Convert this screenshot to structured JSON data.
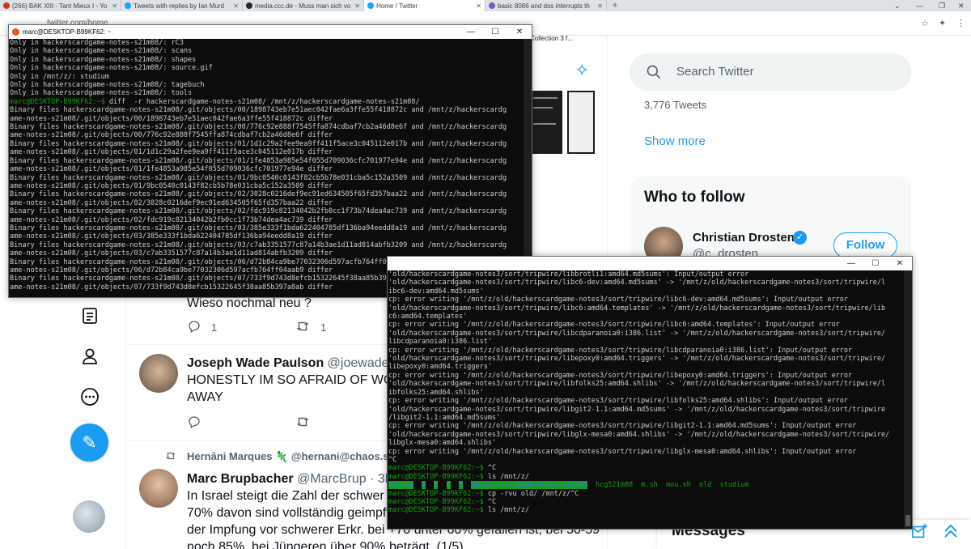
{
  "browser": {
    "tabs": [
      {
        "title": "(266) BAK XIII - Tant Mieux I - Yo",
        "icon": "youtube-icon"
      },
      {
        "title": "Tweets with replies by Ian Murd",
        "icon": "twitter-icon"
      },
      {
        "title": "media.ccc.de - Muss man sich vo",
        "icon": "github-icon"
      },
      {
        "title": "Home / Twitter",
        "icon": "twitter-icon"
      },
      {
        "title": "basic 8086 and dos interrupts th",
        "icon": "page-icon"
      }
    ],
    "url": "twitter.com/home",
    "bookmark_fragment": "Collection 3 f..."
  },
  "twitter": {
    "tweet1": {
      "text": "Wieso nochmal neu ?",
      "reply_count": "1",
      "retweet_count": "1"
    },
    "tweet2": {
      "name": "Joseph Wade Paulson",
      "handle": "@joewadepau",
      "text_line1": "HONESTLY IM SO AFRAID OF WOMEN",
      "text_line2": "AWAY"
    },
    "tweet3": {
      "retweeted_by": "Hernâni Marques 🦎 @hernani@chaos.so",
      "name": "Marc Brupbacher",
      "handle": "@MarcBrup",
      "time": "· 3h",
      "lines": [
        "In Israel steigt die Zahl der schwer Cov",
        "70% davon sind vollständig geimpft. D",
        "der Impfung vor schwerer Erkr. bei +70 unter 60% gefallen ist, bei 50-59",
        "noch 85%, bei Jüngeren über 90% beträgt. (1/5)"
      ]
    },
    "search_placeholder": "Search Twitter",
    "tweets_count": "3,776 Tweets",
    "show_more": "Show more",
    "who_to_follow": "Who to follow",
    "suggestion": {
      "name": "Christian Drosten",
      "handle": "@c_drosten",
      "follow_label": "Follow"
    },
    "messages_title": "Messages",
    "accent_color": "#1d9bf0"
  },
  "terminal1": {
    "title": "marc@DESKTOP-B99KF62: ~",
    "lines": [
      {
        "t": "Only in hackerscardgame-notes-s21m08/: rC3",
        "c": ""
      },
      {
        "t": "Only in hackerscardgame-notes-s21m08/: scans",
        "c": ""
      },
      {
        "t": "Only in hackerscardgame-notes-s21m08/: shapes",
        "c": ""
      },
      {
        "t": "Only in hackerscardgame-notes-s21m08/: source.gif",
        "c": ""
      },
      {
        "t": "Only in /mnt/z/: studium",
        "c": ""
      },
      {
        "t": "Only in hackerscardgame-notes-s21m08/: tagebuch",
        "c": ""
      },
      {
        "t": "Only in hackerscardgame-notes-s21m08/: tools",
        "c": ""
      },
      {
        "t": "marc@DESKTOP-B99KF62:~$ diff  -r hackerscardgame-notes-s21m08/ /mnt/z/hackerscardgame-notes-s21m08/",
        "c": "prompt"
      },
      {
        "t": "Binary files hackerscardgame-notes-s21m08/.git/objects/00/1898743eb7e51aec042fae6a3ffe55f418872c and /mnt/z/hackerscardg",
        "c": ""
      },
      {
        "t": "ame-notes-s21m08/.git/objects/00/1898743eb7e51aec042fae6a3ffe55f418872c differ",
        "c": ""
      },
      {
        "t": "Binary files hackerscardgame-notes-s21m08/.git/objects/00/776c92e888f7545ffa874cdbaf7cb2a46d8e6f and /mnt/z/hackerscardg",
        "c": ""
      },
      {
        "t": "ame-notes-s21m08/.git/objects/00/776c92e888f7545ffa874cdbaf7cb2a46d8e6f differ",
        "c": ""
      },
      {
        "t": "Binary files hackerscardgame-notes-s21m08/.git/objects/01/1d1c29a2fee9ea9ff411f5ace3c045112e017b and /mnt/z/hackerscardg",
        "c": ""
      },
      {
        "t": "ame-notes-s21m08/.git/objects/01/1d1c29a2fee9ea9ff411f5ace3c045112e017b differ",
        "c": ""
      },
      {
        "t": "Binary files hackerscardgame-notes-s21m08/.git/objects/01/1fe4853a985e54f055d709036cfc701977e94e and /mnt/z/hackerscardg",
        "c": ""
      },
      {
        "t": "ame-notes-s21m08/.git/objects/01/1fe4853a985e54f055d709036cfc701977e94e differ",
        "c": ""
      },
      {
        "t": "Binary files hackerscardgame-notes-s21m08/.git/objects/01/9bc0540c0143f82cb5b78e031cba5c152a3509 and /mnt/z/hackerscardg",
        "c": ""
      },
      {
        "t": "ame-notes-s21m08/.git/objects/01/9bc0540c0143f82cb5b78e031cba5c152a3509 differ",
        "c": ""
      },
      {
        "t": "Binary files hackerscardgame-notes-s21m08/.git/objects/02/3028c0216def9ec91ed634505f65fd357baa22 and /mnt/z/hackerscardg",
        "c": ""
      },
      {
        "t": "ame-notes-s21m08/.git/objects/02/3028c0216def9ec91ed634505f65fd357baa22 differ",
        "c": ""
      },
      {
        "t": "Binary files hackerscardgame-notes-s21m08/.git/objects/02/fdc919c82134042b2fb0cc1f73b74dea4ac739 and /mnt/z/hackerscardg",
        "c": ""
      },
      {
        "t": "ame-notes-s21m08/.git/objects/02/fdc919c82134042b2fb0cc1f73b74dea4ac739 differ",
        "c": ""
      },
      {
        "t": "Binary files hackerscardgame-notes-s21m08/.git/objects/03/385e333f1bda622404785df136ba94eedd8a19 and /mnt/z/hackerscardg",
        "c": ""
      },
      {
        "t": "ame-notes-s21m08/.git/objects/03/385e333f1bda622404785df136ba94eedd8a19 differ",
        "c": ""
      },
      {
        "t": "Binary files hackerscardgame-notes-s21m08/.git/objects/03/c7ab3351577c87a14b3ae1d11ad814abfb3209 and /mnt/z/hackerscardg",
        "c": ""
      },
      {
        "t": "ame-notes-s21m08/.git/objects/03/c7ab3351577c87a14b3ae1d11ad814abfb3209 differ",
        "c": ""
      },
      {
        "t": "Binary files hackerscardgame-notes-s21m08/.git/objects/06/d72b84ca9be77032306d597acfb764ff04aab9 and /mnt/z/hackerscardg",
        "c": ""
      },
      {
        "t": "ame-notes-s21m08/.git/objects/06/d72b84ca9be77032306d597acfb764ff04aab9 differ",
        "c": ""
      },
      {
        "t": "Binary files hackerscardgame-notes-s21m08/.git/objects/07/733f9d743d8efcb15322645f38aa85b397a8ab and /mnt/z/hackerscardg",
        "c": ""
      },
      {
        "t": "ame-notes-s21m08/.git/objects/07/733f9d743d8efcb15322645f38aa85b397a8ab differ",
        "c": ""
      }
    ]
  },
  "terminal2": {
    "lines": [
      {
        "t": "'old/hackerscardgame-notes3/sort/tripwire/libbrotli1:amd64.md5sums': Input/output error",
        "c": ""
      },
      {
        "t": "'old/hackerscardgame-notes3/sort/tripwire/libc6-dev:amd64.md5sums' -> '/mnt/z/old/hackerscardgame-notes3/sort/tripwire/l",
        "c": ""
      },
      {
        "t": "ibc6-dev:amd64.md5sums'",
        "c": ""
      },
      {
        "t": "cp: error writing '/mnt/z/old/hackerscardgame-notes3/sort/tripwire/libc6-dev:amd64.md5sums': Input/output error",
        "c": ""
      },
      {
        "t": "'old/hackerscardgame-notes3/sort/tripwire/libc6:amd64.templates' -> '/mnt/z/old/hackerscardgame-notes3/sort/tripwire/lib",
        "c": ""
      },
      {
        "t": "c6:amd64.templates'",
        "c": ""
      },
      {
        "t": "cp: error writing '/mnt/z/old/hackerscardgame-notes3/sort/tripwire/libc6:amd64.templates': Input/output error",
        "c": ""
      },
      {
        "t": "'old/hackerscardgame-notes3/sort/tripwire/libcdparanoia0:i386.list' -> '/mnt/z/old/hackerscardgame-notes3/sort/tripwire/",
        "c": ""
      },
      {
        "t": "libcdparanoia0:i386.list'",
        "c": ""
      },
      {
        "t": "cp: error writing '/mnt/z/old/hackerscardgame-notes3/sort/tripwire/libcdparanoia0:i386.list': Input/output error",
        "c": ""
      },
      {
        "t": "'old/hackerscardgame-notes3/sort/tripwire/libepoxy0:amd64.triggers' -> '/mnt/z/old/hackerscardgame-notes3/sort/tripwire/",
        "c": ""
      },
      {
        "t": "libepoxy0:amd64.triggers'",
        "c": ""
      },
      {
        "t": "cp: error writing '/mnt/z/old/hackerscardgame-notes3/sort/tripwire/libepoxy0:amd64.triggers': Input/output error",
        "c": ""
      },
      {
        "t": "'old/hackerscardgame-notes3/sort/tripwire/libfolks25:amd64.shlibs' -> '/mnt/z/old/hackerscardgame-notes3/sort/tripwire/l",
        "c": ""
      },
      {
        "t": "ibfolks25:amd64.shlibs'",
        "c": ""
      },
      {
        "t": "cp: error writing '/mnt/z/old/hackerscardgame-notes3/sort/tripwire/libfolks25:amd64.shlibs': Input/output error",
        "c": ""
      },
      {
        "t": "'old/hackerscardgame-notes3/sort/tripwire/libgit2-1.1:amd64.md5sums' -> '/mnt/z/old/hackerscardgame-notes3/sort/tripwire",
        "c": ""
      },
      {
        "t": "/libgit2-1.1:amd64.md5sums'",
        "c": ""
      },
      {
        "t": "cp: error writing '/mnt/z/old/hackerscardgame-notes3/sort/tripwire/libgit2-1.1:amd64.md5sums': Input/output error",
        "c": ""
      },
      {
        "t": "'old/hackerscardgame-notes3/sort/tripwire/libglx-mesa0:amd64.shlibs' -> '/mnt/z/old/hackerscardgame-notes3/sort/tripwire/",
        "c": ""
      },
      {
        "t": "libglx-mesa0:amd64.shlibs'",
        "c": ""
      },
      {
        "t": "cp: error writing '/mnt/z/old/hackerscardgame-notes3/sort/tripwire/libglx-mesa0:amd64.shlibs': Input/output error",
        "c": ""
      },
      {
        "t": "^C",
        "c": ""
      },
      {
        "t": "marc@DESKTOP-B99KF62:~$ ^C",
        "c": "prompt"
      },
      {
        "t": "marc@DESKTOP-B99KF62:~$ ls /mnt/z/",
        "c": "prompt"
      },
      {
        "t": "LISTING",
        "c": "ls"
      },
      {
        "t": "marc@DESKTOP-B99KF62:~$ cp -rvu old/ /mnt/z/^C",
        "c": "prompt"
      },
      {
        "t": "marc@DESKTOP-B99KF62:~$ ^C",
        "c": "prompt"
      },
      {
        "t": "marc@DESKTOP-B99KF62:~$ ls /mnt/z/",
        "c": "prompt"
      }
    ],
    "ls_entries": [
      "backup",
      "a",
      "b",
      "c",
      "d",
      "hackerscardgame-notes-s21m08",
      "hcg521m08",
      "m.sh",
      "mou.sh",
      "old",
      "studium"
    ]
  }
}
